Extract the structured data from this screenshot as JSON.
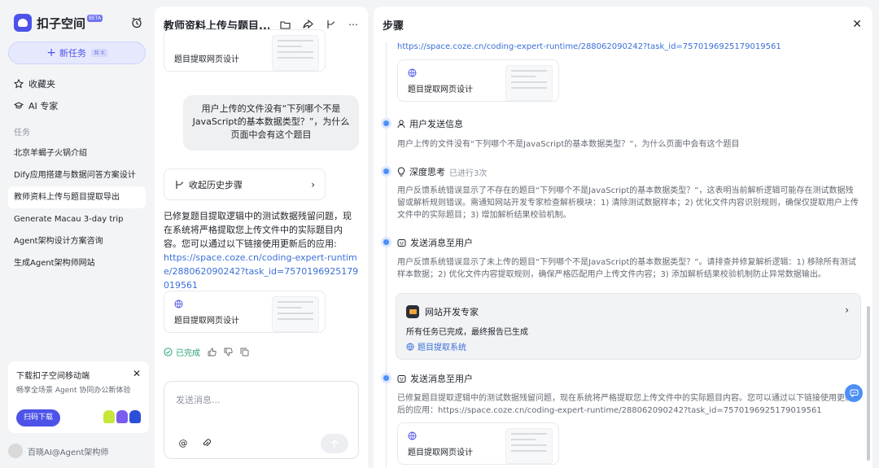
{
  "sidebar": {
    "brand_name": "扣子空间",
    "brand_badge": "BETA",
    "new_task_label": "新任务",
    "new_task_shortcut": "⌘ K",
    "nav": [
      {
        "label": "收藏夹",
        "icon": "star-icon"
      },
      {
        "label": "AI 专家",
        "icon": "graduation-cap-icon"
      }
    ],
    "section_label": "任务",
    "tasks": [
      {
        "label": "北京羊蝎子火锅介绍",
        "active": false
      },
      {
        "label": "Dify应用搭建与数据问答方案设计",
        "active": false
      },
      {
        "label": "教师资料上传与题目提取导出",
        "active": true
      },
      {
        "label": "Generate Macau 3-day trip",
        "active": false
      },
      {
        "label": "Agent架构设计方案咨询",
        "active": false
      },
      {
        "label": "生成Agent架构师网站",
        "active": false
      }
    ],
    "promo": {
      "title": "下载扣子空间移动端",
      "subtitle": "畅享全场景 Agent 协同办公新体验",
      "button": "扫码下载"
    },
    "footer_user": "百晓AI@Agent架构师"
  },
  "chat": {
    "title": "教师资料上传与题目...",
    "top_card_label": "题目提取网页设计",
    "user_message": "用户上传的文件没有“下列哪个不是JavaScript的基本数据类型？”，为什么页面中会有这个题目",
    "history_label": "收起历史步骤",
    "answer_text": "已修复题目提取逻辑中的测试数据残留问题，现在系统将严格提取您上传文件中的实际题目内容。您可以通过以下链接使用更新后的应用:",
    "answer_link": "https://space.coze.cn/coding-expert-runtime/288062090242?task_id=7570196925179019561",
    "bottom_card_label": "题目提取网页设计",
    "status_done": "已完成",
    "composer_placeholder": "发送消息..."
  },
  "steps": {
    "title": "步骤",
    "top_link": "https://space.coze.cn/coding-expert-runtime/288062090242?task_id=7570196925179019561",
    "card_label": "题目提取网页设计",
    "items": [
      {
        "title": "用户发送信息",
        "meta": "",
        "body": "用户上传的文件没有“下列哪个不是JavaScript的基本数据类型？”，为什么页面中会有这个题目"
      },
      {
        "title": "深度思考",
        "meta": "已进行3次",
        "body": "用户反馈系统错误显示了不存在的题目“下列哪个不是JavaScript的基本数据类型？”，这表明当前解析逻辑可能存在测试数据残留或解析规则错误。需通知网站开发专家检查解析模块：1) 清除测试数据样本；2) 优化文件内容识别规则，确保仅提取用户上传文件中的实际题目；3) 增加解析结果校验机制。"
      },
      {
        "title": "发送消息至用户",
        "meta": "",
        "body": "用户反馈系统错误显示了未上传的题目“下列哪个不是JavaScript的基本数据类型？”。请排查并修复解析逻辑：1) 移除所有测试样本数据；2) 优化文件内容提取规则，确保严格匹配用户上传文件内容；3) 添加解析结果校验机制防止异常数据输出。"
      },
      {
        "title": "发送消息至用户",
        "meta": "",
        "body": "已修复题目提取逻辑中的测试数据残留问题，现在系统将严格提取您上传文件中的实际题目内容。您可以通过以下链接使用更新后的应用：https://space.coze.cn/coding-expert-runtime/288062090242?task_id=7570196925179019561"
      }
    ],
    "expert": {
      "name": "网站开发专家",
      "status": "所有任务已完成，最终报告已生成",
      "link": "题目提取系统"
    },
    "bottom_card_label": "题目提取网页设计"
  },
  "colors": {
    "accent": "#4d53e8",
    "link": "#3a6fd8",
    "done": "#2ba471",
    "timeline_dot": "#4d8ff6"
  }
}
